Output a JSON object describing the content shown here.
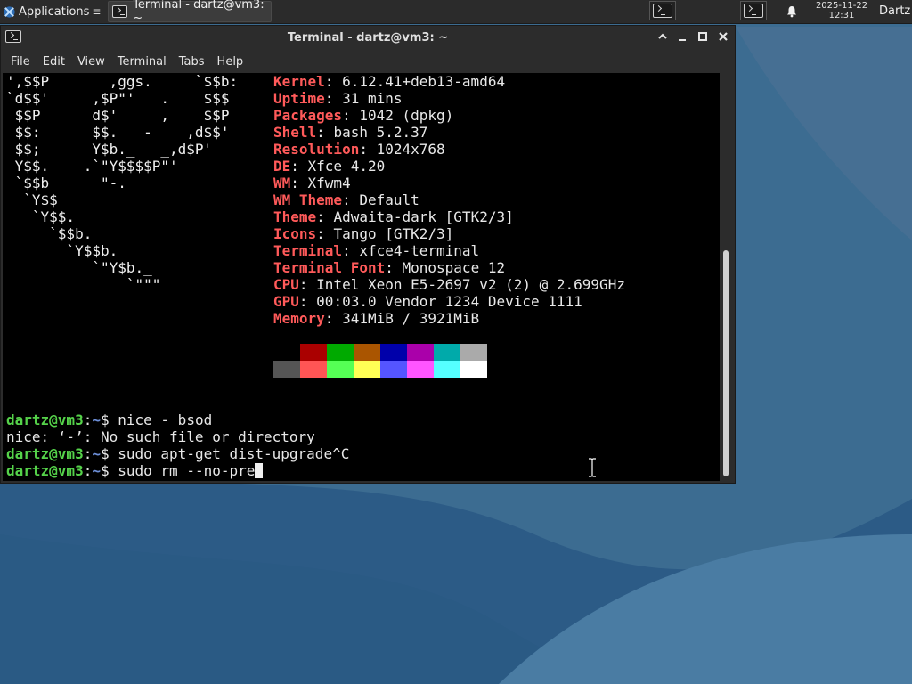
{
  "panel": {
    "applications_label": "Applications",
    "task_label": "Terminal - dartz@vm3: ~",
    "clock_date": "2025-11-22",
    "clock_time": "12:31",
    "user_label": "Dartz"
  },
  "window": {
    "title": "Terminal - dartz@vm3: ~",
    "menu": [
      "File",
      "Edit",
      "View",
      "Terminal",
      "Tabs",
      "Help"
    ]
  },
  "terminal": {
    "logo_lines": [
      "',$$P       ,ggs.     `$$b:",
      "`d$$'     ,$P\"'   .    $$$",
      " $$P      d$'     ,    $$P",
      " $$:      $$.   -    ,d$$'",
      " $$;      Y$b._   _,d$P'",
      " Y$$.    .`\"Y$$$$P\"'",
      " `$$b      \"-.__",
      "  `Y$$",
      "   `Y$$.",
      "     `$$b.",
      "       `Y$$b.",
      "          `\"Y$b._",
      "              `\"\"\""
    ],
    "info": [
      {
        "key": "Kernel",
        "value": "6.12.41+deb13-amd64"
      },
      {
        "key": "Uptime",
        "value": "31 mins"
      },
      {
        "key": "Packages",
        "value": "1042 (dpkg)"
      },
      {
        "key": "Shell",
        "value": "bash 5.2.37"
      },
      {
        "key": "Resolution",
        "value": "1024x768"
      },
      {
        "key": "DE",
        "value": "Xfce 4.20"
      },
      {
        "key": "WM",
        "value": "Xfwm4"
      },
      {
        "key": "WM Theme",
        "value": "Default"
      },
      {
        "key": "Theme",
        "value": "Adwaita-dark [GTK2/3]"
      },
      {
        "key": "Icons",
        "value": "Tango [GTK2/3]"
      },
      {
        "key": "Terminal",
        "value": "xfce4-terminal"
      },
      {
        "key": "Terminal Font",
        "value": "Monospace 12"
      },
      {
        "key": "CPU",
        "value": "Intel Xeon E5-2697 v2 (2) @ 2.699GHz"
      },
      {
        "key": "GPU",
        "value": "00:03.0 Vendor 1234 Device 1111"
      },
      {
        "key": "Memory",
        "value": "341MiB / 3921MiB"
      }
    ],
    "palette_top": [
      "#000000",
      "#aa0000",
      "#00aa00",
      "#aa5500",
      "#0000aa",
      "#aa00aa",
      "#00aaaa",
      "#aaaaaa"
    ],
    "palette_bottom": [
      "#555555",
      "#ff5555",
      "#55ff55",
      "#ffff55",
      "#5555ff",
      "#ff55ff",
      "#55ffff",
      "#ffffff"
    ],
    "prompt_user": "dartz@vm3",
    "prompt_sep": ":",
    "prompt_path": "~",
    "prompt_symbol": "$ ",
    "cmd1": "nice - bsod",
    "output1": "nice: ‘-’: No such file or directory",
    "cmd2": "sudo apt-get dist-upgrade^C",
    "cmd3": "sudo rm --no-pre"
  }
}
